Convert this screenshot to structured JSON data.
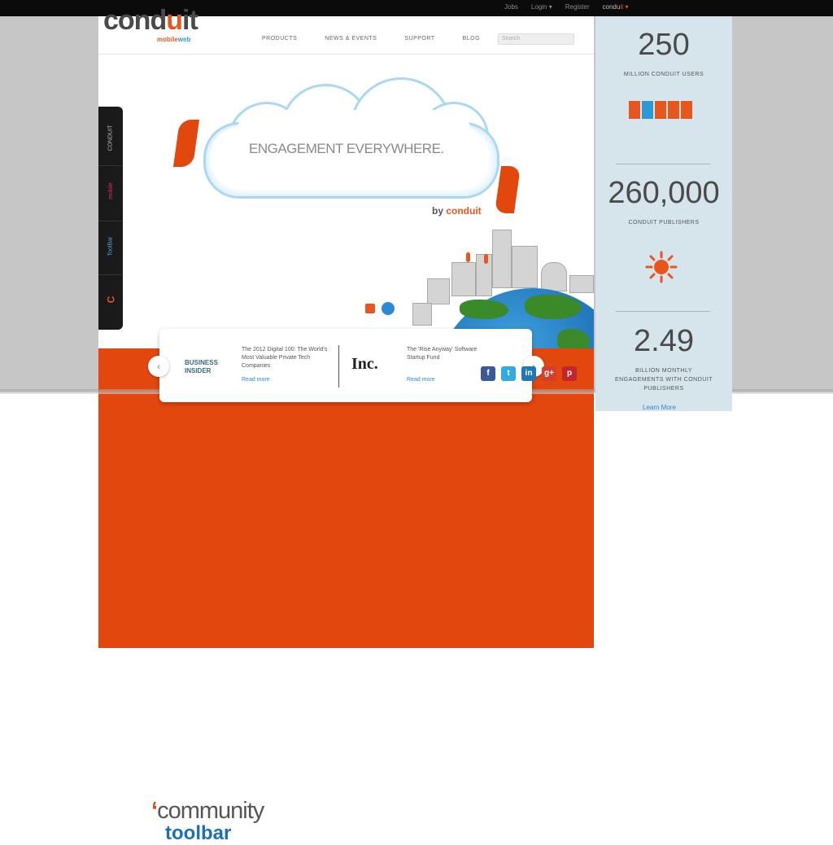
{
  "topbar": {
    "links": [
      "Jobs",
      "Login ▾",
      "Register"
    ],
    "brand_a": "condu",
    "brand_b": "it ▾"
  },
  "header": {
    "logo_a": "cond",
    "logo_b": "u",
    "logo_c": "it",
    "logo_sub_a": "mobile",
    "logo_sub_b": "web",
    "nav": [
      "PRODUCTS",
      "NEWS & EVENTS",
      "SUPPORT",
      "BLOG"
    ],
    "search_placeholder": "Search"
  },
  "sidetabs": [
    "CONDUIT",
    "mobile",
    "ToolBar",
    "C"
  ],
  "hero": {
    "headline": "ENGAGEMENT EVERYWHERE.",
    "byline_a": "by ",
    "byline_b": "conduit"
  },
  "press": {
    "logo1_line1": "BUSINESS",
    "logo1_line2": "INSIDER",
    "text1": "The 2012 Digital 100: The World's Most Valuable Private Tech Companies",
    "more1": "Read more",
    "logo2": "Inc.",
    "text2": "The 'Rise Anyway' Software Startup Fund",
    "more2": "Read more",
    "arrow_left": "‹",
    "arrow_right": "›"
  },
  "social": [
    "f",
    "t",
    "in",
    "g+",
    "p"
  ],
  "stats": [
    {
      "value": "250",
      "label": "MILLION CONDUIT USERS"
    },
    {
      "value": "260,000",
      "label": "CONDUIT PUBLISHERS"
    },
    {
      "value": "2.49",
      "label": "BILLION MONTHLY ENGAGEMENTS WITH CONDUIT PUBLISHERS"
    }
  ],
  "stats_more": "Learn More",
  "footer": {
    "community_quote": "‘",
    "community": "community",
    "toolbar": "toolbar"
  },
  "colors": {
    "accent_orange": "#e2470e",
    "brand_blue": "#2a8ad6",
    "stats_bg": "#d6e4ec"
  },
  "icons": [
    "people-icon",
    "sun-icon",
    "facebook-icon",
    "twitter-icon",
    "linkedin-icon",
    "googleplus-icon",
    "pinterest-icon"
  ]
}
